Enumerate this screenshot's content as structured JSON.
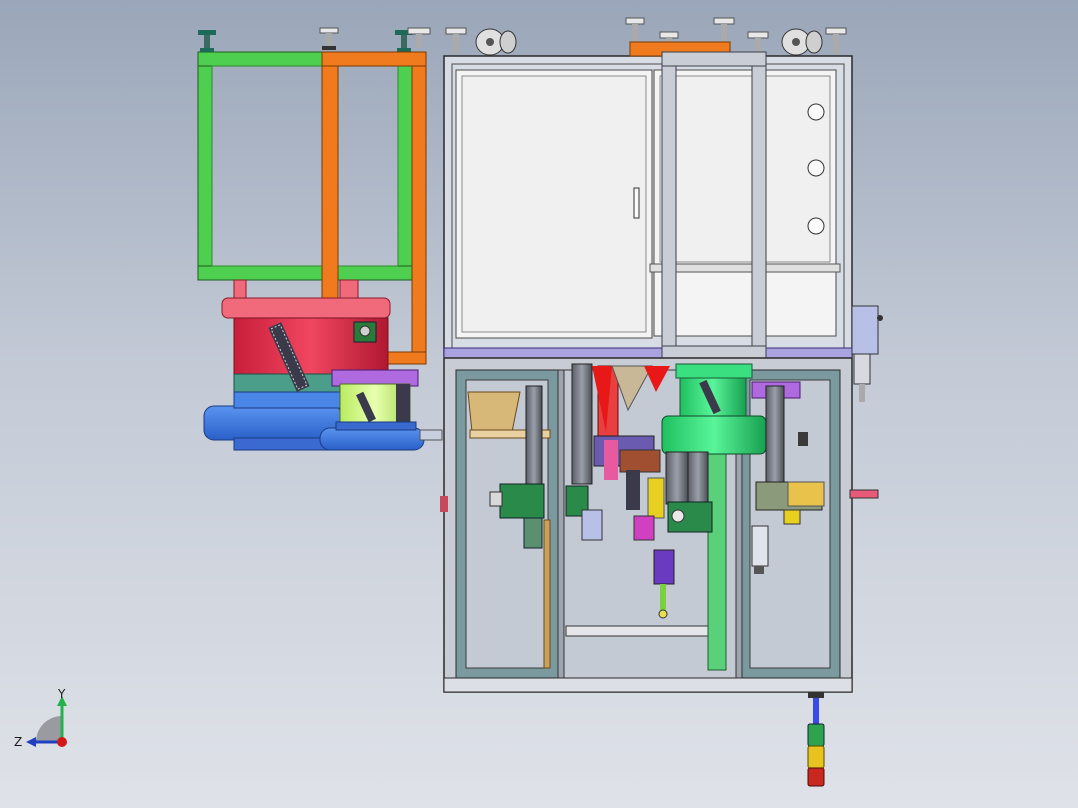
{
  "viewport": {
    "background_top": "#9aa6b9",
    "background_bottom": "#dfe2e8"
  },
  "triad": {
    "y_axis_label": "Y",
    "z_axis_label": "Z",
    "y_axis_color": "#22b14c",
    "z_axis_color": "#1f3fbf",
    "x_origin_color": "#d01818"
  },
  "palette": {
    "frame_green": "#4fcf4f",
    "frame_orange": "#f07a1e",
    "cabinet_white": "#f2f2f2",
    "frame_gray": "#c9cdd6",
    "feeder_red": "#e8304a",
    "feeder_pink": "#f06a7c",
    "bowl_blue": "#3a78e0",
    "bowl_green": "#34e07a",
    "lavender": "#a9a3e0",
    "tower_green": "#2ea44f",
    "tower_yellow": "#e8c21e",
    "tower_red": "#c8281e"
  }
}
